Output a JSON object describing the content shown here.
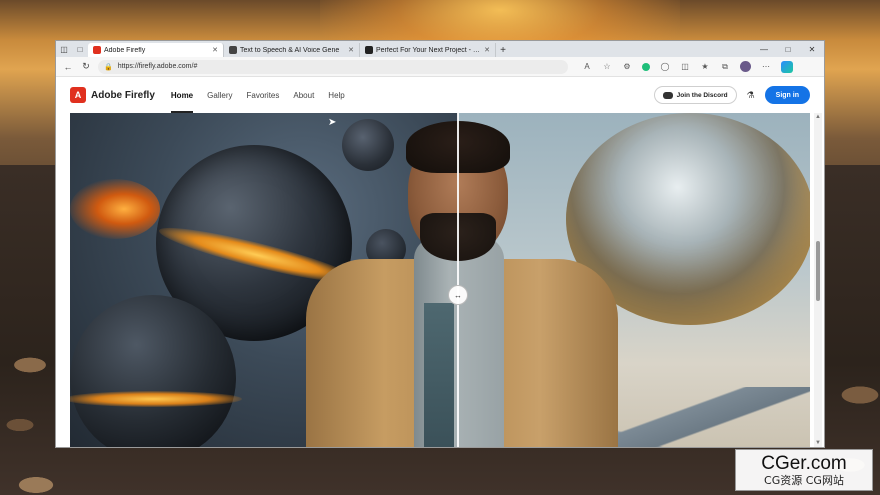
{
  "browser": {
    "tabs": [
      {
        "title": "Adobe Firefly",
        "favicon_color": "#e0301e",
        "active": true
      },
      {
        "title": "Text to Speech & AI Voice Gene",
        "favicon_color": "#444444",
        "active": false
      },
      {
        "title": "Perfect For Your Next Project - …",
        "favicon_color": "#222222",
        "active": false
      }
    ],
    "url": "https://firefly.adobe.com/#"
  },
  "site": {
    "brand": "Adobe Firefly",
    "brand_mark": "A",
    "nav": [
      {
        "label": "Home",
        "active": true
      },
      {
        "label": "Gallery",
        "active": false
      },
      {
        "label": "Favorites",
        "active": false
      },
      {
        "label": "About",
        "active": false
      },
      {
        "label": "Help",
        "active": false
      }
    ],
    "discord_label": "Join the Discord",
    "signin_label": "Sign in",
    "accent_color": "#1473e6"
  },
  "watermark": {
    "main": "CGer.com",
    "sub": "CG资源 CG网站"
  }
}
